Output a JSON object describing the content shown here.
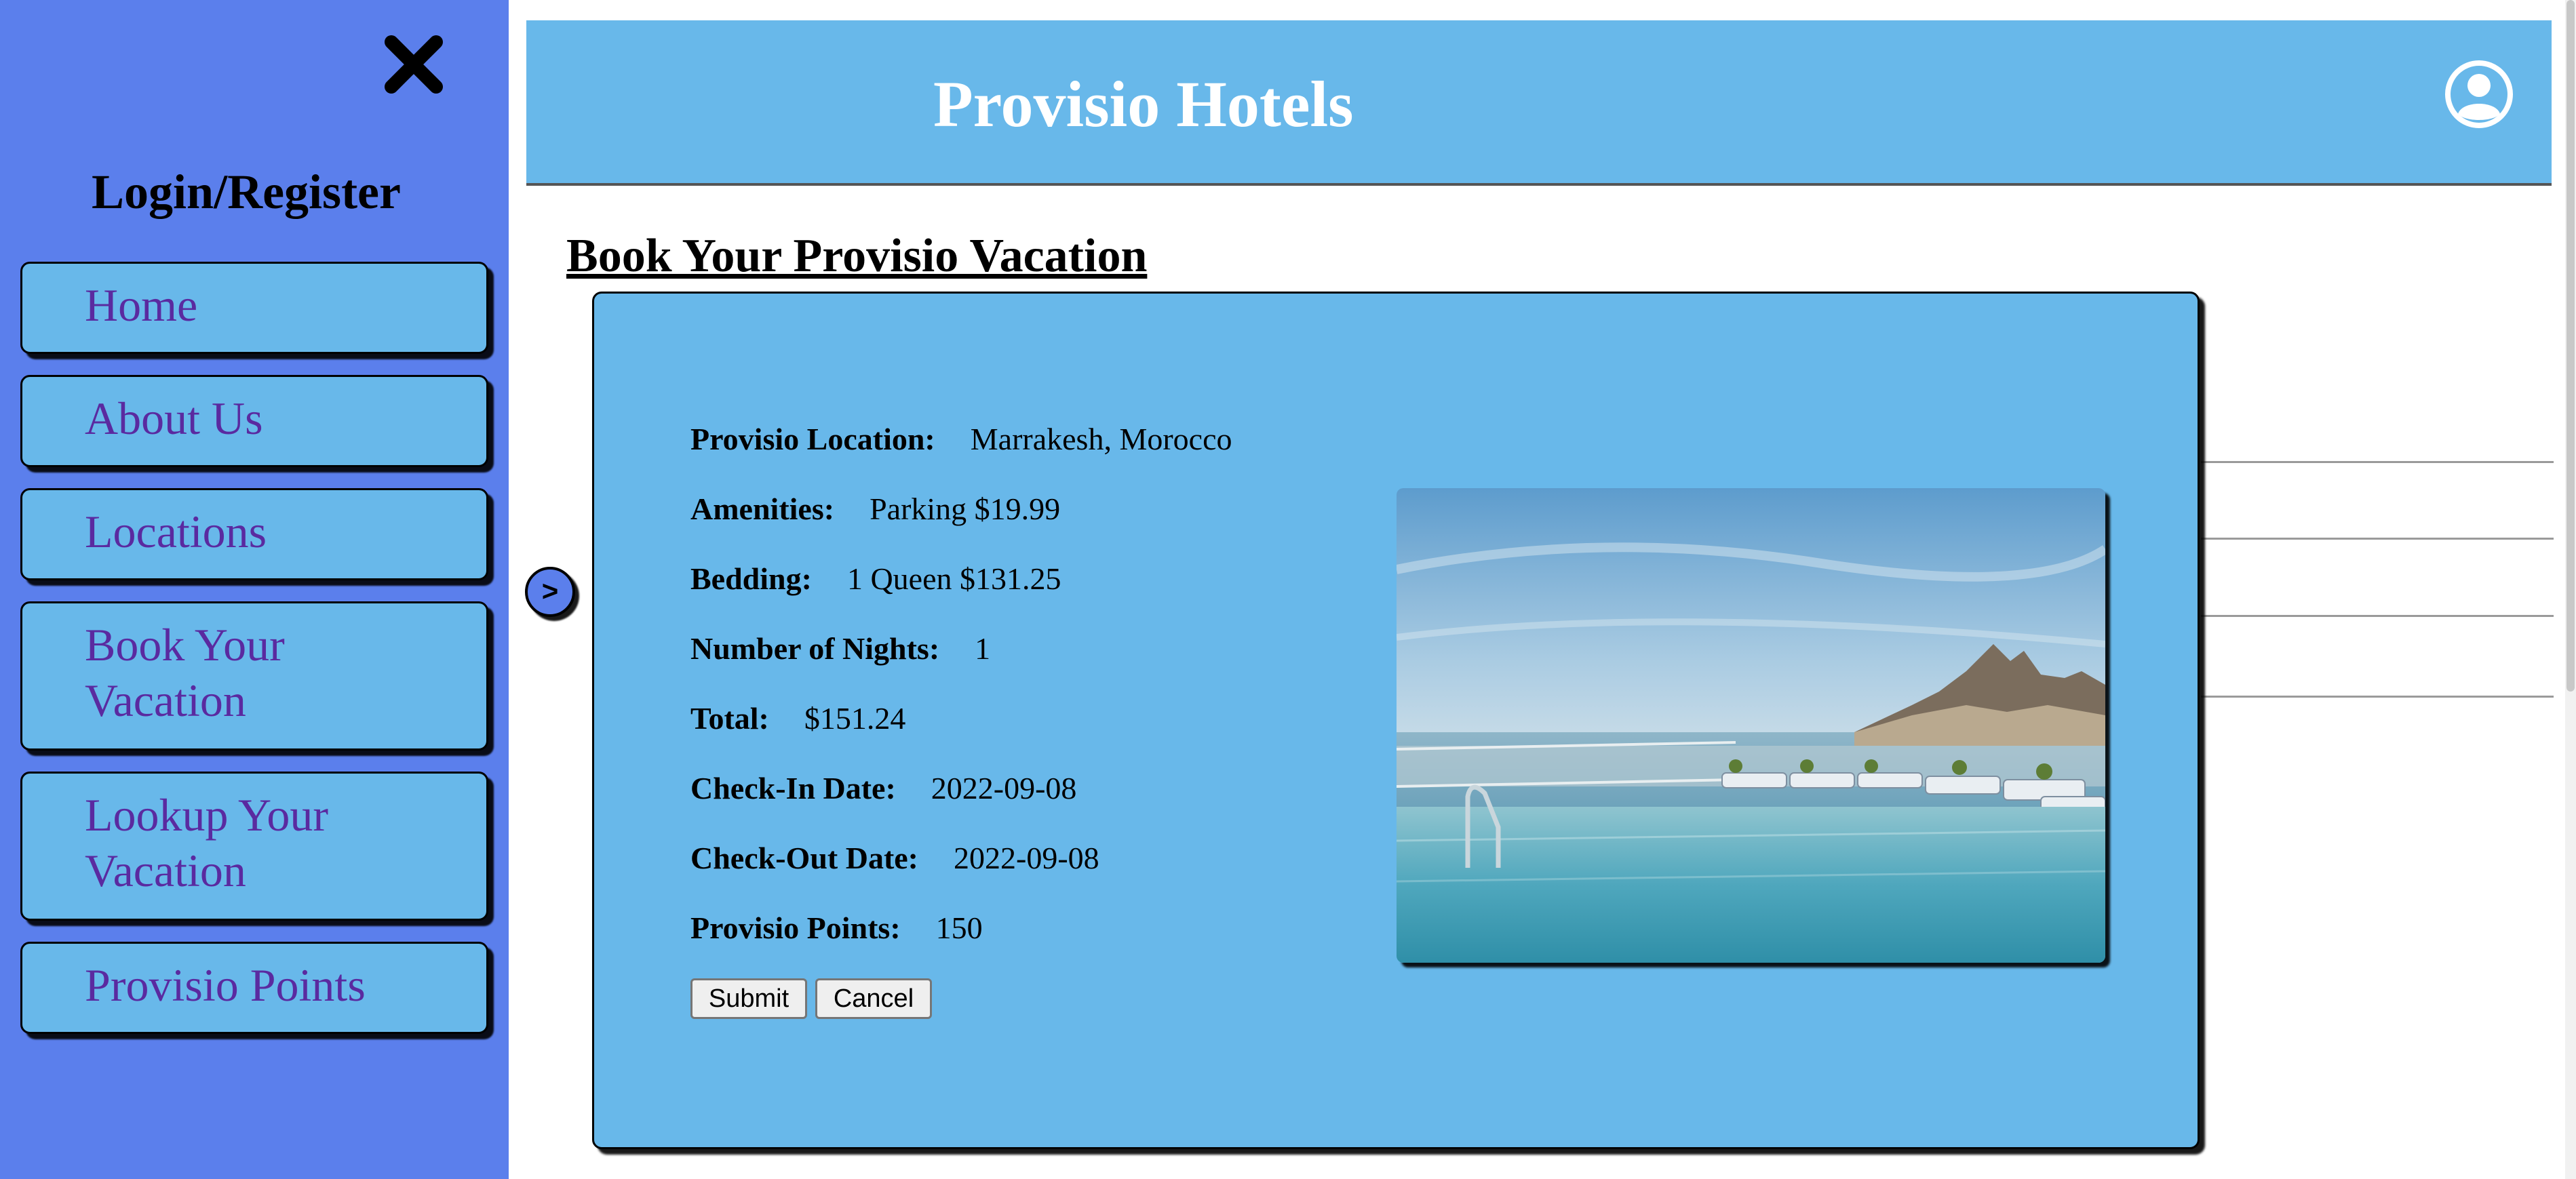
{
  "sidebar": {
    "close_icon": "close-x-icon",
    "login_label": "Login/Register",
    "items": [
      {
        "label": "Home"
      },
      {
        "label": "About Us"
      },
      {
        "label": "Locations"
      },
      {
        "label": "Book Your Vacation"
      },
      {
        "label": "Lookup Your Vacation"
      },
      {
        "label": "Provisio Points"
      }
    ]
  },
  "header": {
    "title": "Provisio Hotels",
    "account_icon": "user-circle-icon"
  },
  "main": {
    "heading": "Book Your Provisio Vacation",
    "prev_arrow": ">",
    "booking": {
      "fields": [
        {
          "label": "Provisio Location:",
          "value": "Marrakesh, Morocco"
        },
        {
          "label": "Amenities:",
          "value": "Parking $19.99"
        },
        {
          "label": "Bedding:",
          "value": "1 Queen $131.25"
        },
        {
          "label": "Number of Nights:",
          "value": "1"
        },
        {
          "label": "Total:",
          "value": "$151.24"
        },
        {
          "label": "Check-In Date:",
          "value": "2022-09-08"
        },
        {
          "label": "Check-Out Date:",
          "value": "2022-09-08"
        },
        {
          "label": "Provisio Points:",
          "value": "150"
        }
      ],
      "submit_label": "Submit",
      "cancel_label": "Cancel",
      "image_icon": "hotel-pool-photo"
    }
  },
  "colors": {
    "sidebar_bg": "#5b7fec",
    "panel_bg": "#68b8ea",
    "nav_text": "#5a2aa0",
    "title_text": "#ffffff"
  }
}
